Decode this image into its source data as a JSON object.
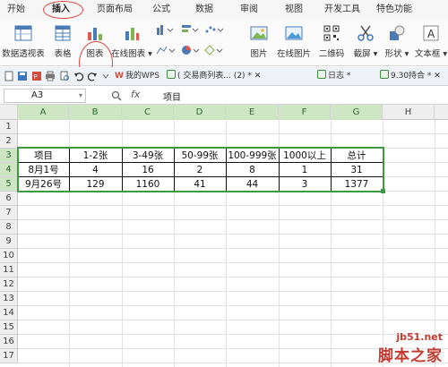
{
  "ribbon_tabs": [
    "开始",
    "插入",
    "页面布局",
    "公式",
    "数据",
    "审阅",
    "视图",
    "开发工具",
    "特色功能"
  ],
  "active_tab": "插入",
  "ribbon_buttons": {
    "pivot": "数据透视表",
    "table": "表格",
    "chart": "图表",
    "online_chart": "在线图表 ▾",
    "picture": "图片",
    "online_picture": "在线图片",
    "qrcode": "二维码",
    "screenshot": "截屏 ▾",
    "shapes": "形状 ▾",
    "textbox": "文本框 ▾"
  },
  "doc_tabs": {
    "wps": "我的WPS",
    "doc1": "( 交易商列表... (2) * ✕",
    "doc2": "日志 *",
    "doc3": "9.30持合 * ✕"
  },
  "formula_bar": {
    "name_box": "A3",
    "fx": "fx",
    "value": "项目"
  },
  "columns": [
    "A",
    "B",
    "C",
    "D",
    "E",
    "F",
    "G",
    "H"
  ],
  "rows": [
    "1",
    "2",
    "3",
    "4",
    "5",
    "6",
    "7",
    "8",
    "9",
    "10",
    "11",
    "12",
    "13",
    "14",
    "15",
    "16",
    "17"
  ],
  "table": {
    "header": [
      "项目",
      "1-2张",
      "3-49张",
      "50-99张",
      "100-999张",
      "1000以上",
      "总计"
    ],
    "rows": [
      [
        "8月1号",
        "4",
        "16",
        "2",
        "8",
        "1",
        "31"
      ],
      [
        "9月26号",
        "129",
        "1160",
        "41",
        "44",
        "3",
        "1377"
      ]
    ]
  },
  "watermark": {
    "line1": "jb51.net",
    "line2": "脚本之家"
  },
  "colors": {
    "accent_green": "#3f9a3f",
    "annotation_red": "#e0433b"
  }
}
